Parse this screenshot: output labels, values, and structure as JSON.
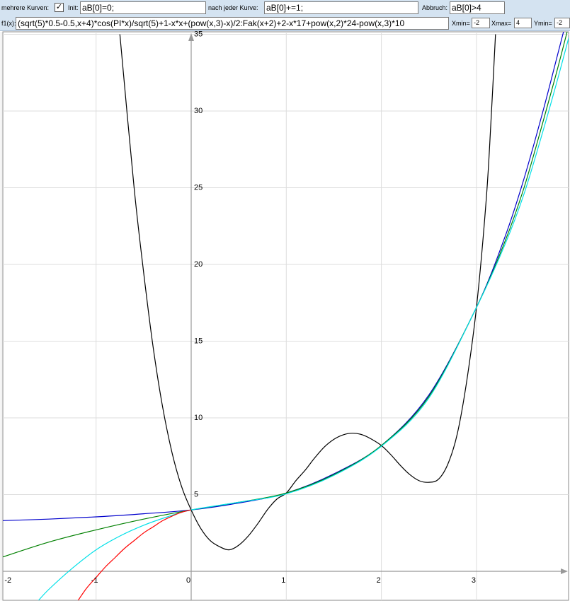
{
  "toolbar": {
    "multi_label": "mehrere Kurven:",
    "multi_checked": true,
    "init_label": "Init:",
    "init_value": "aB[0]=0;",
    "after_label": "nach jeder Kurve:",
    "after_value": "aB[0]+=1;",
    "abort_label": "Abbruch:",
    "abort_value": "aB[0]>4",
    "f1_label": "f1(x):",
    "f1_value": "(sqrt(5)*0.5-0.5,x+4)*cos(PI*x)/sqrt(5)+1-x*x+(pow(x,3)-x)/2:Fak(x+2)+2-x*17+pow(x,2)*24-pow(x,3)*10",
    "xmin_label": "Xmin=",
    "xmin_value": "-2",
    "xmax_label": "Xmax=",
    "xmax_value": "4",
    "ymin_label": "Ymin=",
    "ymin_value": "-2"
  },
  "chart_data": {
    "type": "line",
    "xlim": [
      -2,
      4
    ],
    "ylim": [
      -2,
      35
    ],
    "grid": true,
    "x_ticks": [
      -2,
      -1,
      0,
      1,
      2,
      3
    ],
    "x_tick_labels": [
      "-2",
      "-1",
      "0",
      "1",
      "2",
      "3"
    ],
    "y_ticks": [
      5,
      10,
      15,
      20,
      25,
      30,
      35
    ],
    "y_tick_labels": [
      "5",
      "10",
      "15",
      "20",
      "25",
      "30",
      "35"
    ],
    "series": [
      {
        "color": "#000000",
        "x": [
          -0.75,
          -0.6,
          -0.5,
          -0.4,
          -0.3,
          -0.2,
          -0.1,
          0,
          0.1,
          0.2,
          0.3,
          0.4,
          0.5,
          0.6,
          0.7,
          0.8,
          0.9,
          1,
          1.1,
          1.2,
          1.3,
          1.4,
          1.5,
          1.6,
          1.7,
          1.8,
          1.9,
          2,
          2.1,
          2.2,
          2.3,
          2.4,
          2.5,
          2.6,
          2.7,
          2.8,
          2.9,
          3,
          3.1,
          3.15,
          3.2
        ],
        "y": [
          35.0,
          25.0,
          19.5,
          14.6,
          10.7,
          7.7,
          5.5,
          4.0,
          2.8,
          2.0,
          1.6,
          1.4,
          1.7,
          2.3,
          3.1,
          4.0,
          4.7,
          5.1,
          5.9,
          6.6,
          7.4,
          8.1,
          8.6,
          8.9,
          9.0,
          8.9,
          8.6,
          8.2,
          7.6,
          6.9,
          6.3,
          5.9,
          5.8,
          6.0,
          7.0,
          9.0,
          12.5,
          17.2,
          24.0,
          29.0,
          35.0
        ]
      },
      {
        "color": "#0000cc",
        "x": [
          -2,
          -1.5,
          -1,
          -0.5,
          0,
          0.5,
          1,
          1.5,
          2,
          2.5,
          3,
          3.3,
          3.5,
          3.7,
          3.85,
          3.95
        ],
        "y": [
          3.3,
          3.4,
          3.55,
          3.75,
          4.0,
          4.45,
          5.1,
          6.35,
          8.2,
          11.5,
          17.2,
          21.8,
          25.6,
          30.0,
          33.6,
          36.0
        ]
      },
      {
        "color": "#008000",
        "x": [
          -2,
          -1.5,
          -1,
          -0.5,
          0,
          0.5,
          1,
          1.5,
          2,
          2.5,
          3,
          3.3,
          3.5,
          3.7,
          3.85,
          3.98
        ],
        "y": [
          0.9,
          1.9,
          2.7,
          3.4,
          4.0,
          4.5,
          5.1,
          6.3,
          8.2,
          11.4,
          17.2,
          21.5,
          25.0,
          29.3,
          32.7,
          35.8
        ]
      },
      {
        "color": "#00e0e8",
        "x": [
          -1.62,
          -1.5,
          -1.25,
          -1,
          -0.75,
          -0.5,
          -0.25,
          0,
          0.5,
          1,
          1.5,
          2,
          2.5,
          3,
          3.3,
          3.5,
          3.7,
          3.85,
          3.98
        ],
        "y": [
          -2.0,
          -1.2,
          0.2,
          1.4,
          2.3,
          3.0,
          3.55,
          4.0,
          4.5,
          5.05,
          6.25,
          8.15,
          11.3,
          17.2,
          21.3,
          24.6,
          28.7,
          32.0,
          35.0
        ]
      },
      {
        "color": "#ff0000",
        "x": [
          -1.2,
          -1.1,
          -1,
          -0.9,
          -0.8,
          -0.7,
          -0.6,
          -0.5,
          -0.4,
          -0.3,
          -0.2,
          -0.1,
          0
        ],
        "y": [
          -2.0,
          -1.1,
          -0.4,
          0.3,
          0.9,
          1.5,
          2.0,
          2.5,
          2.9,
          3.3,
          3.6,
          3.85,
          4.0
        ]
      }
    ]
  }
}
